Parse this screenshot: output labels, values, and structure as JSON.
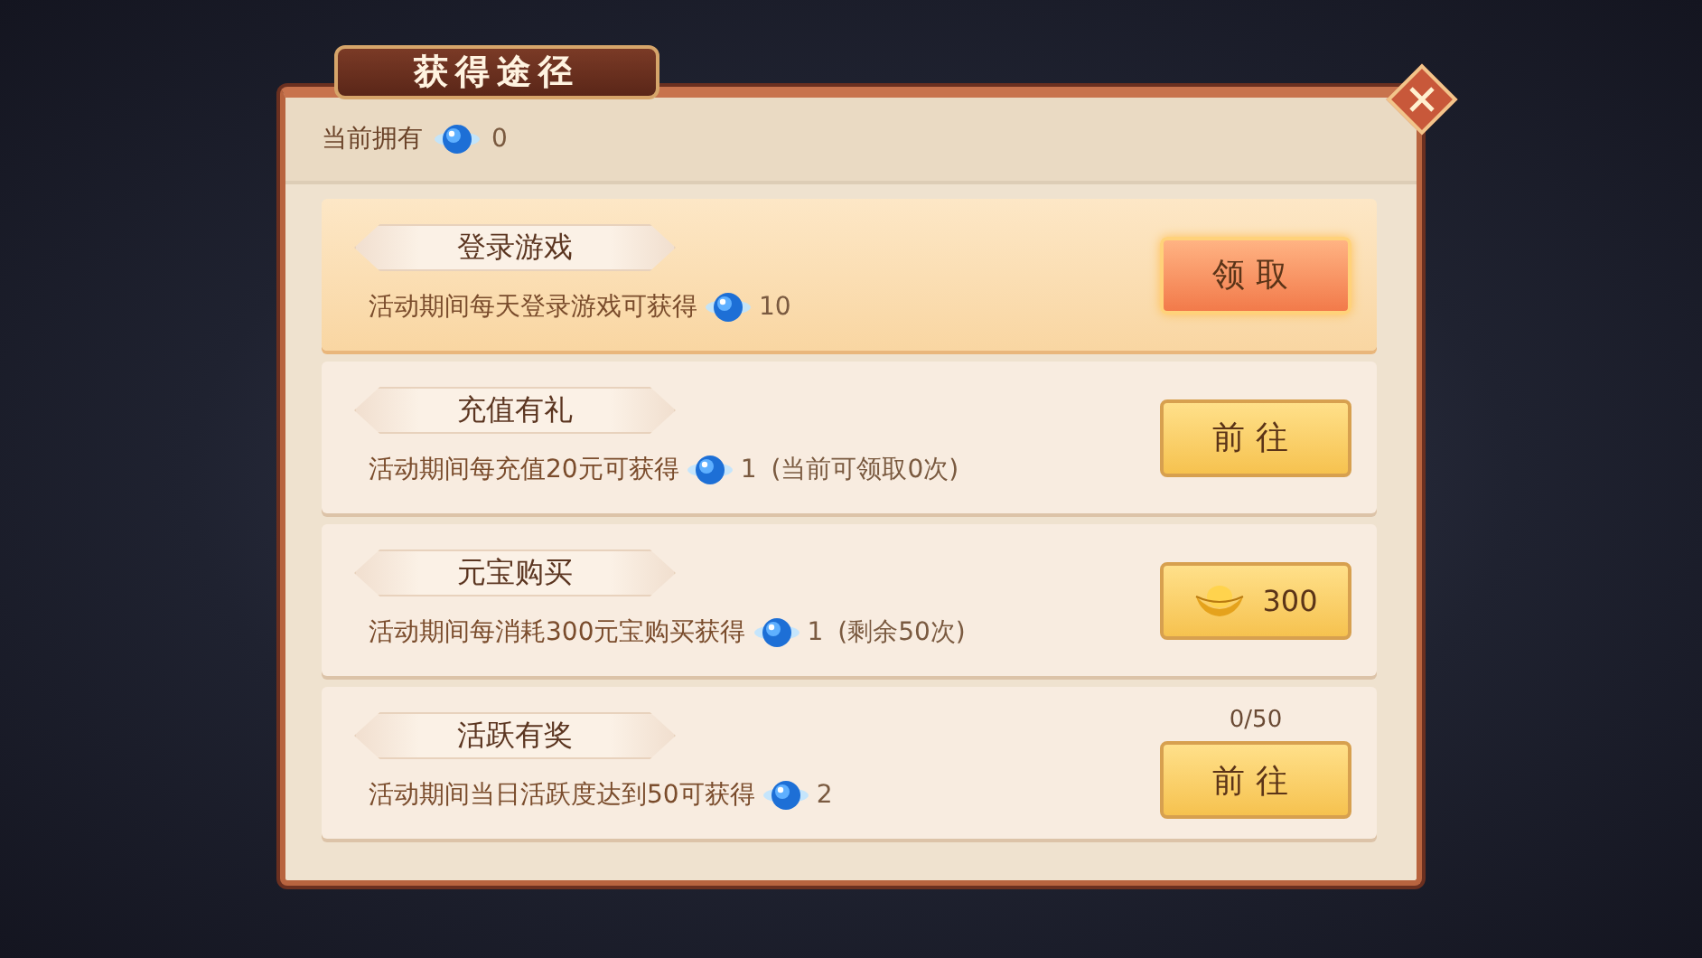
{
  "window": {
    "title": "获得途径"
  },
  "owned": {
    "label": "当前拥有",
    "amount": "0"
  },
  "rows": [
    {
      "title": "登录游戏",
      "description": "活动期间每天登录游戏可获得",
      "amount": "10",
      "button": {
        "kind": "claim",
        "label": "领取"
      },
      "claimable": true
    },
    {
      "title": "充值有礼",
      "description": "活动期间每充值20元可获得",
      "amount": "1",
      "note": "(当前可领取0次)",
      "button": {
        "kind": "go",
        "label": "前往"
      },
      "claimable": false
    },
    {
      "title": "元宝购买",
      "description": "活动期间每消耗300元宝购买获得",
      "amount": "1",
      "note": "(剩余50次)",
      "button": {
        "kind": "price",
        "label": "300"
      },
      "claimable": false
    },
    {
      "title": "活跃有奖",
      "description": "活动期间当日活跃度达到50可获得",
      "amount": "2",
      "progress": "0/50",
      "button": {
        "kind": "go",
        "label": "前往"
      },
      "claimable": false
    }
  ]
}
